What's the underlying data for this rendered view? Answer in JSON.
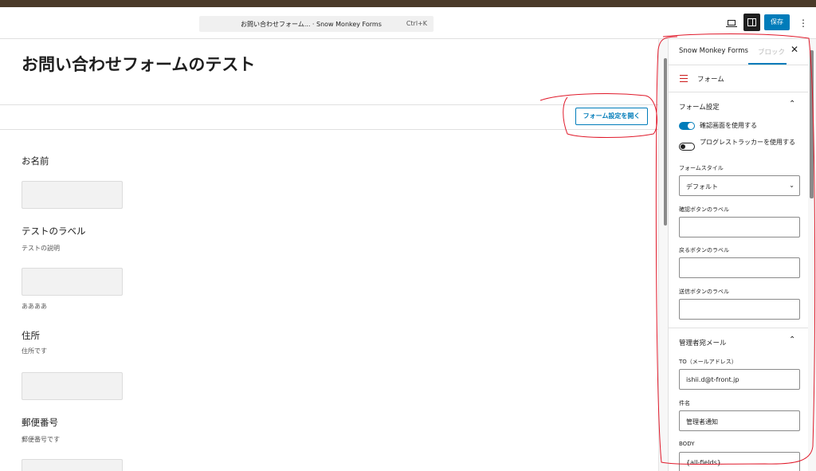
{
  "header": {
    "command_title": "お問い合わせフォーム... · Snow Monkey Forms",
    "command_shortcut": "Ctrl+K",
    "save_label": "保存",
    "more_label": "⋮"
  },
  "editor": {
    "page_title": "お問い合わせフォームのテスト",
    "open_settings_label": "フォーム設定を開く",
    "fields": [
      {
        "label": "お名前",
        "description": "",
        "note": ""
      },
      {
        "label": "テストのラベル",
        "description": "テストの説明",
        "note": "ああああ"
      },
      {
        "label": "住所",
        "description": "住所です",
        "note": ""
      },
      {
        "label": "郵便番号",
        "description": "郵便番号です",
        "note": ""
      }
    ]
  },
  "sidebar": {
    "tab_forms": "Snow Monkey Forms",
    "tab_block": "ブロック",
    "close_label": "✕",
    "form_block_label": "フォーム",
    "form_settings": {
      "title": "フォーム設定",
      "toggle_confirm": "確認画面を使用する",
      "toggle_progress": "プログレストラッカーを使用する",
      "style_label": "フォームスタイル",
      "style_value": "デフォルト",
      "confirm_btn_label": "確認ボタンのラベル",
      "back_btn_label": "戻るボタンのラベル",
      "send_btn_label": "送信ボタンのラベル"
    },
    "admin_mail": {
      "title": "管理者宛メール",
      "to_label": "TO（メールアドレス）",
      "to_value": "ishii.d@t-front.jp",
      "subject_label": "件名",
      "subject_value": "管理者通知",
      "body_label": "BODY",
      "body_value": "{all-fields}"
    }
  }
}
